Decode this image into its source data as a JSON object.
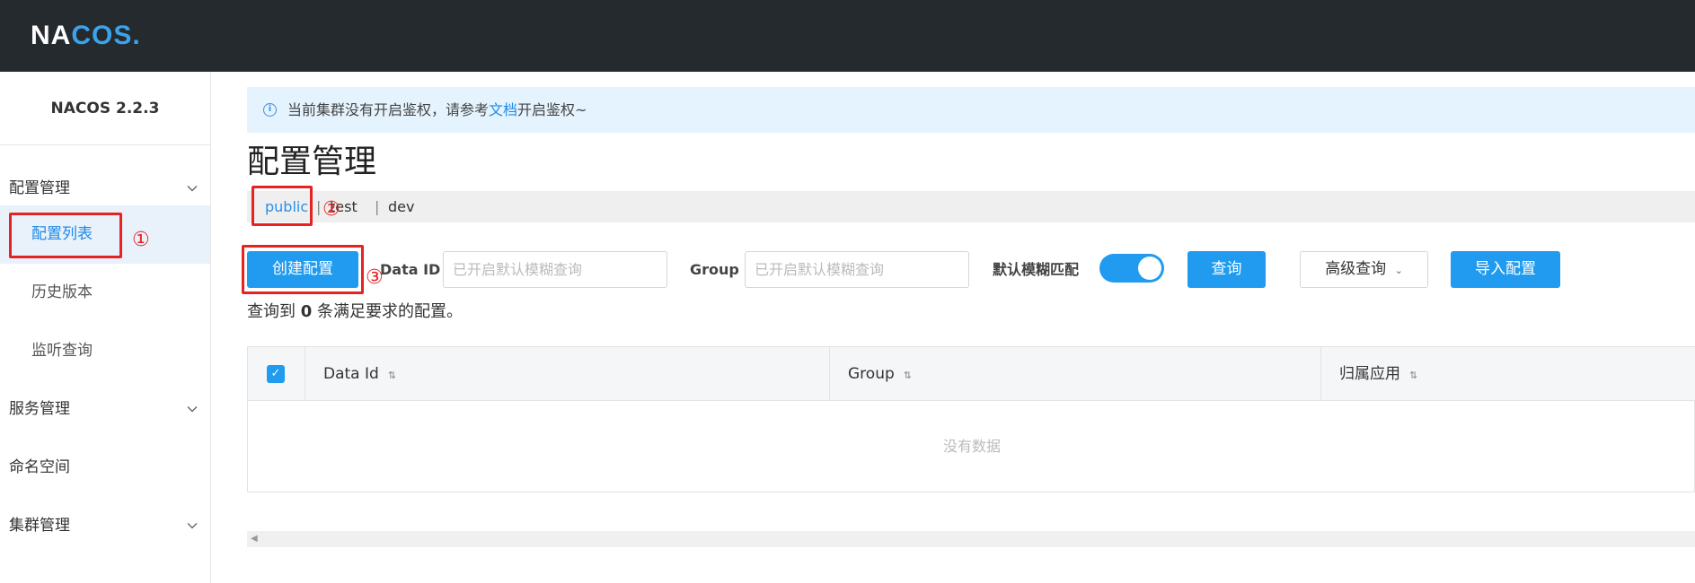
{
  "app": {
    "logo_text_1": "NA",
    "logo_text_2": "COS",
    "logo_text_3": "."
  },
  "sidebar": {
    "version": "NACOS 2.2.3",
    "items": [
      {
        "label": "配置管理",
        "type": "group"
      },
      {
        "label": "配置列表",
        "type": "sub",
        "active": true
      },
      {
        "label": "历史版本",
        "type": "sub"
      },
      {
        "label": "监听查询",
        "type": "sub"
      },
      {
        "label": "服务管理",
        "type": "group"
      },
      {
        "label": "命名空间",
        "type": "plain"
      },
      {
        "label": "集群管理",
        "type": "group"
      }
    ]
  },
  "notice": {
    "prefix": "当前集群没有开启鉴权，请参考",
    "link": "文档",
    "suffix": "开启鉴权~",
    "icon": "info-icon"
  },
  "page_title": "配置管理",
  "namespaces": [
    "public",
    "test",
    "dev"
  ],
  "namespace_separator": "|",
  "annotations": {
    "one": "①",
    "two": "②",
    "three": "③"
  },
  "toolbar": {
    "create_button": "创建配置",
    "dataid_label": "Data ID",
    "dataid_placeholder": "已开启默认模糊查询",
    "group_label": "Group",
    "group_placeholder": "已开启默认模糊查询",
    "fuzzy_label": "默认模糊匹配",
    "fuzzy_on": true,
    "query_button": "查询",
    "advanced_button": "高级查询",
    "import_button": "导入配置"
  },
  "result": {
    "prefix": "查询到",
    "count": "0",
    "suffix": "条满足要求的配置。"
  },
  "table": {
    "columns": [
      "Data Id",
      "Group",
      "归属应用"
    ],
    "empty_text": "没有数据"
  },
  "colors": {
    "primary": "#209bef",
    "highlight": "#e52323",
    "topbar": "#252a2f"
  }
}
